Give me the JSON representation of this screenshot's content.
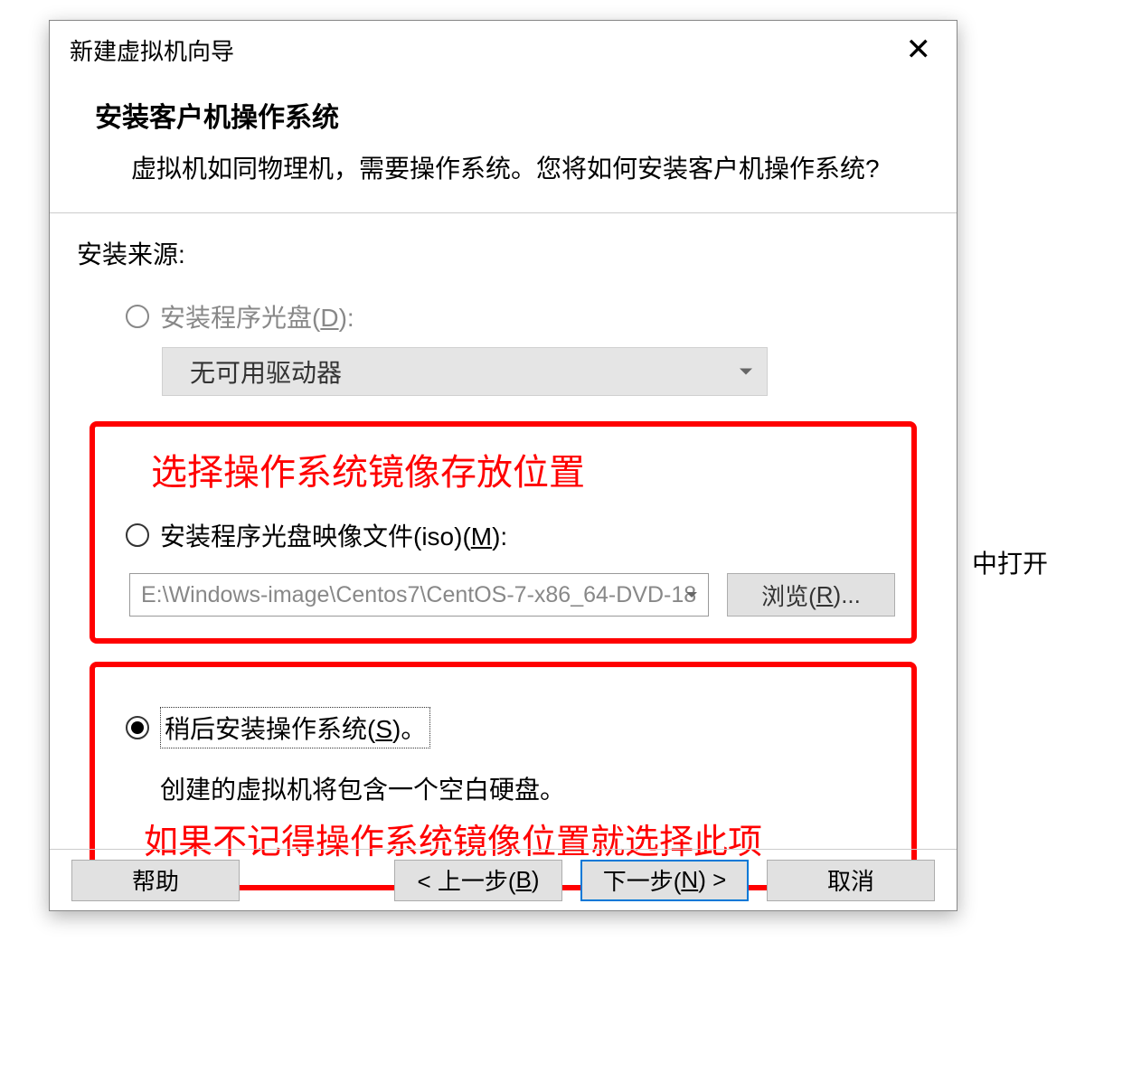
{
  "dialog": {
    "title": "新建虚拟机向导",
    "close": "✕"
  },
  "header": {
    "title": "安装客户机操作系统",
    "desc": "虚拟机如同物理机，需要操作系统。您将如何安装客户机操作系统?"
  },
  "source": {
    "label": "安装来源:"
  },
  "option_disc": {
    "label_prefix": "安装程序光盘(",
    "label_hotkey": "D",
    "label_suffix": "):",
    "dropdown": "无可用驱动器"
  },
  "annotation1": "选择操作系统镜像存放位置",
  "option_iso": {
    "label_prefix": "安装程序光盘映像文件(iso)(",
    "label_hotkey": "M",
    "label_suffix": "):",
    "path": "E:\\Windows-image\\Centos7\\CentOS-7-x86_64-DVD-18",
    "browse_prefix": "浏览(",
    "browse_hotkey": "R",
    "browse_suffix": ")..."
  },
  "option_later": {
    "label_prefix": "稍后安装操作系统(",
    "label_hotkey": "S",
    "label_suffix": ")。",
    "desc": "创建的虚拟机将包含一个空白硬盘。"
  },
  "annotation2": "如果不记得操作系统镜像位置就选择此项",
  "buttons": {
    "help": "帮助",
    "back_prefix": "< 上一步(",
    "back_hotkey": "B",
    "back_suffix": ")",
    "next_prefix": "下一步(",
    "next_hotkey": "N",
    "next_suffix": ") >",
    "cancel": "取消"
  },
  "outside": "中打开"
}
